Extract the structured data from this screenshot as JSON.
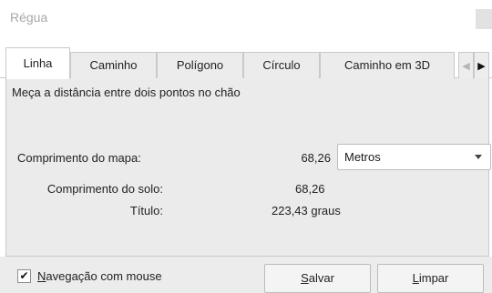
{
  "window": {
    "title": "Régua"
  },
  "tabs": [
    {
      "label": "Linha",
      "active": true
    },
    {
      "label": "Caminho",
      "active": false
    },
    {
      "label": "Polígono",
      "active": false
    },
    {
      "label": "Círculo",
      "active": false
    },
    {
      "label": "Caminho em 3D",
      "active": false
    }
  ],
  "tab_scroll": {
    "left_icon": "chevron-left-icon",
    "right_icon": "chevron-right-icon"
  },
  "panel": {
    "description": "Meça a distância entre dois pontos no chão",
    "map_length_label": "Comprimento do mapa:",
    "map_length_value": "68,26",
    "unit_selected": "Metros",
    "ground_length_label": "Comprimento do solo:",
    "ground_length_value": "68,26",
    "heading_label": "Título:",
    "heading_value": "223,43 graus"
  },
  "footer": {
    "mouse_nav_checked": true,
    "mouse_nav_label_mnemonic": "N",
    "mouse_nav_label_rest": "avegação com mouse",
    "save_mnemonic": "S",
    "save_rest": "alvar",
    "clear_mnemonic": "L",
    "clear_rest": "impar"
  },
  "colors": {
    "panel_bg": "#ebebeb",
    "tab_inactive_bg": "#ececec",
    "title_text": "#a8a8a8"
  }
}
